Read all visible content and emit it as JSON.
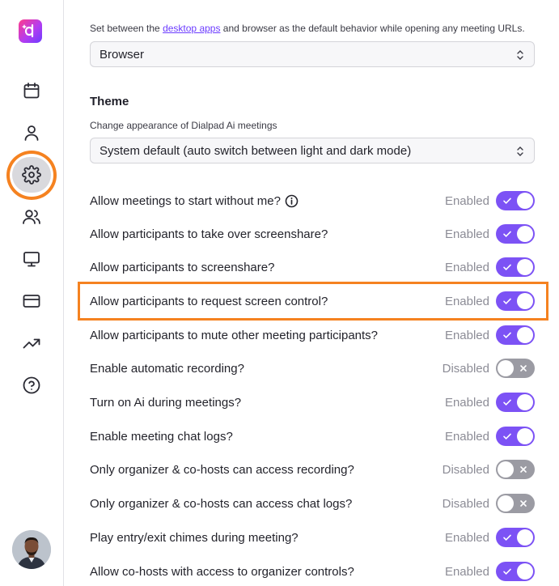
{
  "nav": {
    "logo_icon": "dialpad-logo-icon",
    "items": [
      {
        "icon": "calendar-icon"
      },
      {
        "icon": "user-icon"
      },
      {
        "icon": "gear-icon",
        "active": true
      },
      {
        "icon": "users-icon"
      },
      {
        "icon": "monitor-icon"
      },
      {
        "icon": "credit-card-icon"
      },
      {
        "icon": "trending-up-icon"
      },
      {
        "icon": "help-circle-icon"
      }
    ],
    "avatar_icon": "user-avatar"
  },
  "default_app": {
    "desc_before": "Set between the ",
    "desc_link": "desktop apps",
    "desc_after": " and browser as the default behavior while opening any meeting URLs.",
    "value": "Browser"
  },
  "theme": {
    "title": "Theme",
    "desc": "Change appearance of Dialpad Ai meetings",
    "value": "System default (auto switch between light and dark mode)"
  },
  "settings": [
    {
      "label": "Allow meetings to start without me?",
      "status": "Enabled",
      "on": true,
      "info": true
    },
    {
      "label": "Allow participants to take over screenshare?",
      "status": "Enabled",
      "on": true
    },
    {
      "label": "Allow participants to screenshare?",
      "status": "Enabled",
      "on": true
    },
    {
      "label": "Allow participants to request screen control?",
      "status": "Enabled",
      "on": true
    },
    {
      "label": "Allow participants to mute other meeting participants?",
      "status": "Enabled",
      "on": true
    },
    {
      "label": "Enable automatic recording?",
      "status": "Disabled",
      "on": false
    },
    {
      "label": "Turn on Ai during meetings?",
      "status": "Enabled",
      "on": true
    },
    {
      "label": "Enable meeting chat logs?",
      "status": "Enabled",
      "on": true
    },
    {
      "label": "Only organizer & co-hosts can access recording?",
      "status": "Disabled",
      "on": false
    },
    {
      "label": "Only organizer & co-hosts can access chat logs?",
      "status": "Disabled",
      "on": false
    },
    {
      "label": "Play entry/exit chimes during meeting?",
      "status": "Enabled",
      "on": true
    },
    {
      "label": "Allow co-hosts with access to organizer controls?",
      "status": "Enabled",
      "on": true
    }
  ],
  "colors": {
    "accent": "#7c52f5",
    "toggle_off": "#9b9ba3",
    "highlight": "#f58220",
    "link": "#6c3cff"
  }
}
